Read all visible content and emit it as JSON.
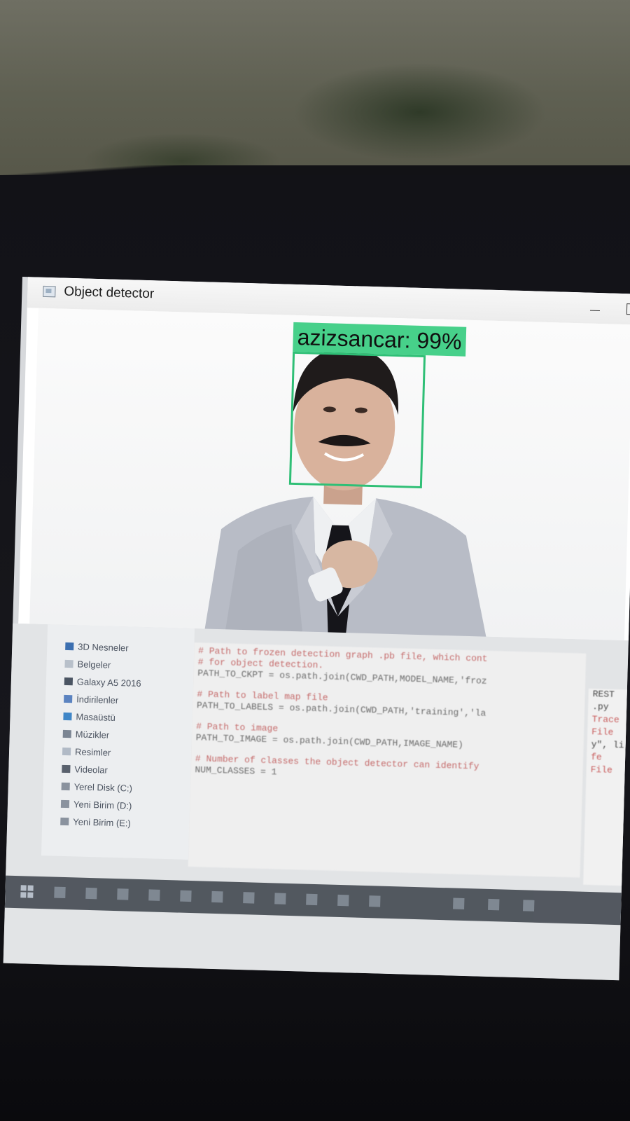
{
  "window": {
    "title": "Object detector"
  },
  "detection": {
    "class_name": "azizsancar",
    "score_pct": 99,
    "label": "azizsancar: 99%"
  },
  "explorer": {
    "items": [
      {
        "label": "3D Nesneler",
        "icon": "cube-icon"
      },
      {
        "label": "Belgeler",
        "icon": "documents-icon"
      },
      {
        "label": "Galaxy A5 2016",
        "icon": "phone-icon"
      },
      {
        "label": "İndirilenler",
        "icon": "download-icon"
      },
      {
        "label": "Masaüstü",
        "icon": "desktop-icon"
      },
      {
        "label": "Müzikler",
        "icon": "music-icon"
      },
      {
        "label": "Resimler",
        "icon": "pictures-icon"
      },
      {
        "label": "Videolar",
        "icon": "videos-icon"
      },
      {
        "label": "Yerel Disk (C:)",
        "icon": "drive-icon"
      },
      {
        "label": "Yeni Birim (D:)",
        "icon": "drive-icon"
      },
      {
        "label": "Yeni Birim (E:)",
        "icon": "drive-icon"
      }
    ]
  },
  "code": {
    "lines": [
      {
        "text": "# Path to frozen detection graph .pb file, which cont",
        "type": "comment"
      },
      {
        "text": "# for object detection.",
        "type": "comment"
      },
      {
        "text": "PATH_TO_CKPT = os.path.join(CWD_PATH,MODEL_NAME,'froz",
        "type": "code"
      },
      {
        "text": "# Path to label map file",
        "type": "comment"
      },
      {
        "text": "PATH_TO_LABELS = os.path.join(CWD_PATH,'training','la",
        "type": "comment"
      },
      {
        "text": "# Path to image",
        "type": "comment"
      },
      {
        "text": "PATH_TO_IMAGE = os.path.join(CWD_PATH,IMAGE_NAME)",
        "type": "code"
      },
      {
        "text": "# Number of classes the object detector can identify",
        "type": "comment"
      },
      {
        "text": "NUM_CLASSES = 1",
        "type": "code"
      }
    ]
  },
  "console": {
    "lines": [
      {
        "text": "REST",
        "type": "normal"
      },
      {
        "text": ".py",
        "type": "normal"
      },
      {
        "text": "Trace",
        "type": "err"
      },
      {
        "text": "File",
        "type": "err"
      },
      {
        "text": "y\", li",
        "type": "normal"
      },
      {
        "text": "fe",
        "type": "err"
      },
      {
        "text": "File",
        "type": "err"
      }
    ]
  }
}
